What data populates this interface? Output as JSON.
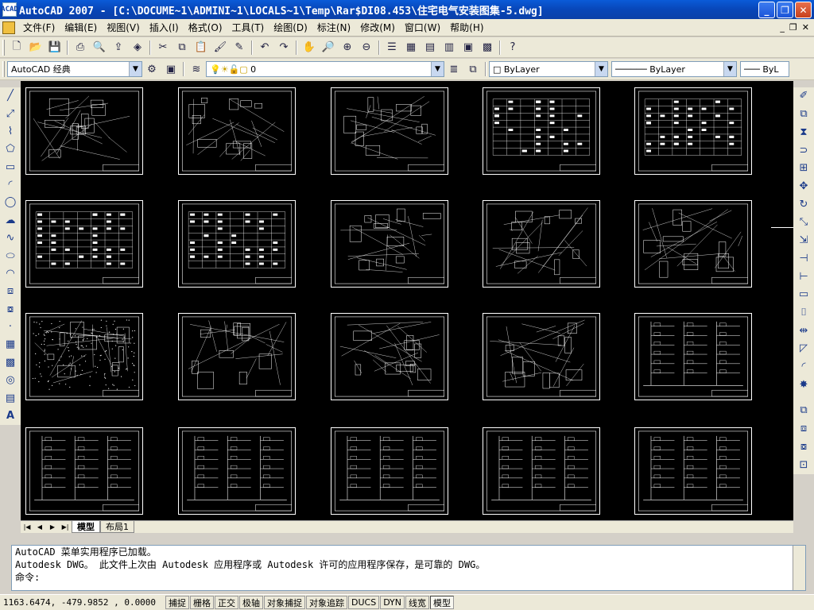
{
  "window": {
    "title": "AutoCAD 2007 - [C:\\DOCUME~1\\ADMINI~1\\LOCALS~1\\Temp\\Rar$DI08.453\\住宅电气安装图集-5.dwg]",
    "app_icon": "ACAD",
    "minimize": "_",
    "restore": "❐",
    "close": "✕"
  },
  "menu": {
    "items": [
      "文件(F)",
      "编辑(E)",
      "视图(V)",
      "插入(I)",
      "格式(O)",
      "工具(T)",
      "绘图(D)",
      "标注(N)",
      "修改(M)",
      "窗口(W)",
      "帮助(H)"
    ],
    "window_controls": [
      "_",
      "❐",
      "✕"
    ]
  },
  "toolbar2": {
    "workspace": "AutoCAD 经典",
    "layer": "0",
    "color": "ByLayer",
    "linetype": "ByLayer",
    "lineweight": "ByL"
  },
  "layout_tabs": {
    "model": "模型",
    "layout1": "布局1",
    "nav": [
      "|◀",
      "◀",
      "▶",
      "▶|"
    ]
  },
  "command": {
    "lines": [
      "AutoCAD 菜单实用程序已加载。",
      "Autodesk DWG。  此文件上次由 Autodesk 应用程序或 Autodesk 许可的应用程序保存，是可靠的 DWG。"
    ],
    "prompt": "命令:"
  },
  "status": {
    "coords": "1163.6474, -479.9852 , 0.0000",
    "toggles": [
      "捕捉",
      "栅格",
      "正交",
      "极轴",
      "对象捕捉",
      "对象追踪",
      "DUCS",
      "DYN",
      "线宽",
      "模型"
    ]
  },
  "colors": {
    "titlebar": "#0846b8",
    "canvas": "#000000",
    "chrome": "#ece9d8"
  },
  "icons": {
    "left_toolbar": [
      "line-icon",
      "construction-line-icon",
      "polyline-icon",
      "polygon-icon",
      "rectangle-icon",
      "arc-icon",
      "circle-icon",
      "revision-cloud-icon",
      "spline-icon",
      "ellipse-icon",
      "ellipse-arc-icon",
      "insert-block-icon",
      "make-block-icon",
      "point-icon",
      "hatch-icon",
      "gradient-icon",
      "region-icon",
      "table-icon",
      "multiline-text-icon"
    ],
    "right_toolbar": [
      "erase-icon",
      "copy-icon",
      "mirror-icon",
      "offset-icon",
      "array-icon",
      "move-icon",
      "rotate-icon",
      "scale-icon",
      "stretch-icon",
      "trim-icon",
      "extend-icon",
      "break-at-point-icon",
      "break-icon",
      "join-icon",
      "chamfer-icon",
      "fillet-icon",
      "explode-icon"
    ]
  }
}
